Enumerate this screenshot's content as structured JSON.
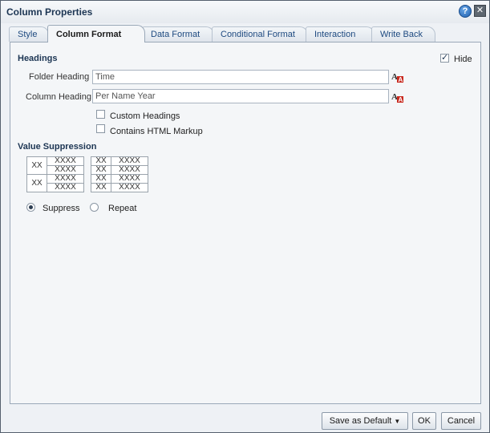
{
  "dialog": {
    "title": "Column Properties",
    "help_icon": "help-icon",
    "close_icon": "close-icon"
  },
  "tabs": [
    {
      "label": "Style",
      "active": false
    },
    {
      "label": "Column Format",
      "active": true
    },
    {
      "label": "Data Format",
      "active": false
    },
    {
      "label": "Conditional Format",
      "active": false
    },
    {
      "label": "Interaction",
      "active": false
    },
    {
      "label": "Write Back",
      "active": false
    }
  ],
  "headings": {
    "section_label": "Headings",
    "hide_label": "Hide",
    "hide_checked": true,
    "folder_heading_label": "Folder Heading",
    "folder_heading_value": "Time",
    "column_heading_label": "Column Heading",
    "column_heading_value": "Per Name Year",
    "custom_headings_label": "Custom Headings",
    "custom_headings_checked": false,
    "contains_html_label": "Contains HTML Markup",
    "contains_html_checked": false
  },
  "value_suppression": {
    "section_label": "Value Suppression",
    "sample_outer": "XX",
    "sample_inner": "XXXX",
    "suppress_label": "Suppress",
    "repeat_label": "Repeat",
    "selected": "Suppress"
  },
  "footer": {
    "save_default_label": "Save as Default",
    "ok_label": "OK",
    "cancel_label": "Cancel"
  }
}
